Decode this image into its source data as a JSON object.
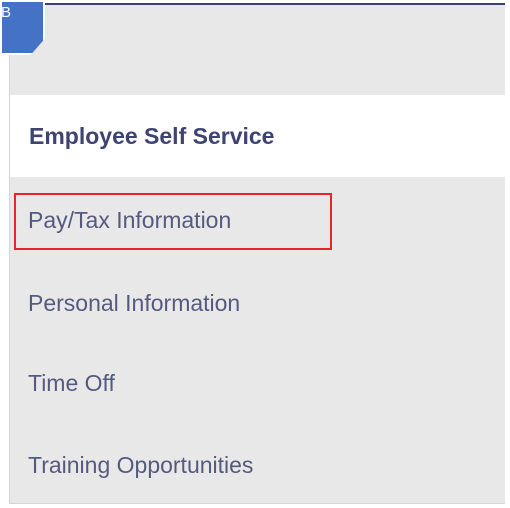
{
  "step_badge": {
    "label": "B",
    "color": "#4472c4"
  },
  "menu": {
    "header": "Employee Self Service",
    "items": [
      {
        "label": "Pay/Tax Information",
        "highlighted": true
      },
      {
        "label": "Personal Information",
        "highlighted": false
      },
      {
        "label": "Time Off",
        "highlighted": false
      },
      {
        "label": "Training Opportunities",
        "highlighted": false
      }
    ]
  },
  "colors": {
    "header_text": "#3e4370",
    "item_text": "#555a7e",
    "menu_background": "#e8e8e8",
    "highlight_border": "#e8242a",
    "top_rule": "#3b3f6b"
  }
}
